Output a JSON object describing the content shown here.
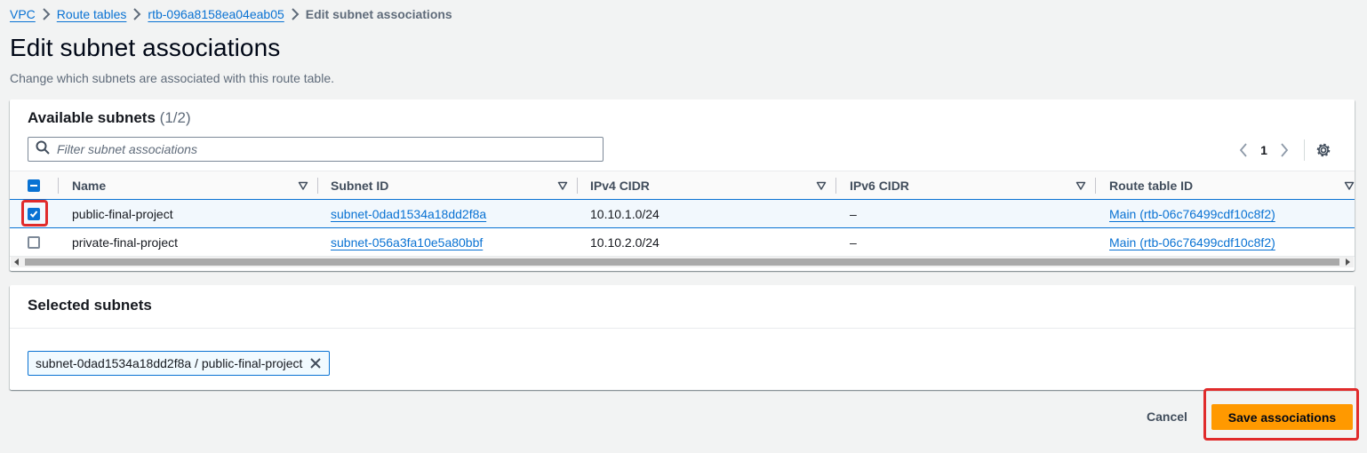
{
  "breadcrumb": {
    "items": [
      "VPC",
      "Route tables",
      "rtb-096a8158ea04eab05"
    ],
    "current": "Edit subnet associations"
  },
  "page": {
    "title": "Edit subnet associations",
    "description": "Change which subnets are associated with this route table."
  },
  "available": {
    "title": "Available subnets",
    "count": "(1/2)",
    "filter_placeholder": "Filter subnet associations",
    "page_number": "1",
    "columns": [
      "Name",
      "Subnet ID",
      "IPv4 CIDR",
      "IPv6 CIDR",
      "Route table ID"
    ],
    "rows": [
      {
        "name": "public-final-project",
        "subnet_id": "subnet-0dad1534a18dd2f8a",
        "ipv4": "10.10.1.0/24",
        "ipv6": "–",
        "route_table": "Main (rtb-06c76499cdf10c8f2)",
        "checked": true
      },
      {
        "name": "private-final-project",
        "subnet_id": "subnet-056a3fa10e5a80bbf",
        "ipv4": "10.10.2.0/24",
        "ipv6": "–",
        "route_table": "Main (rtb-06c76499cdf10c8f2)",
        "checked": false
      }
    ]
  },
  "selected": {
    "title": "Selected subnets",
    "token": "subnet-0dad1534a18dd2f8a / public-final-project"
  },
  "actions": {
    "cancel": "Cancel",
    "save": "Save associations"
  },
  "colors": {
    "link": "#0972d3",
    "primary_button": "#ff9900",
    "highlight": "#e02b2b"
  }
}
